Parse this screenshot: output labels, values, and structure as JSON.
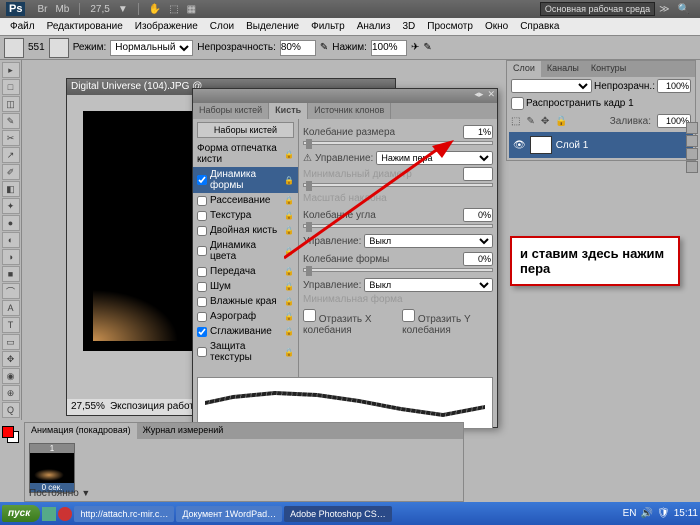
{
  "top": {
    "ps": "Ps",
    "br": "Br",
    "mb": "Mb",
    "zoom": "27,5",
    "hand": "✋",
    "workspace": "Основная рабочая среда",
    "chev": "≫"
  },
  "menu": [
    "Файл",
    "Редактирование",
    "Изображение",
    "Слои",
    "Выделение",
    "Фильтр",
    "Анализ",
    "3D",
    "Просмотр",
    "Окно",
    "Справка"
  ],
  "opt": {
    "size": "551",
    "mode_lbl": "Режим:",
    "mode": "Нормальный",
    "opac_lbl": "Непрозрачность:",
    "opac": "80%",
    "flow_lbl": "Нажим:",
    "flow": "100%"
  },
  "tools": [
    "▸",
    "□",
    "◫",
    "✎",
    "✂",
    "↗",
    "✐",
    "◧",
    "✦",
    "●",
    "◐",
    "◑",
    "■",
    "⌒",
    "A",
    "T",
    "▭",
    "✥",
    "◉",
    "⊕",
    "Q"
  ],
  "doc": {
    "title": "Digital Universe (104).JPG @",
    "zoom": "27,55%",
    "status": "Экспозиция работае"
  },
  "layers": {
    "tabs": [
      "Слои",
      "Каналы",
      "Контуры"
    ],
    "opac_lbl": "Непрозрачн.:",
    "opac": "100%",
    "lock_lbl": "Распространить кадр 1",
    "fill_lbl": "Заливка:",
    "fill": "100%",
    "layer": "Слой 1"
  },
  "note": "и ставим здесь нажим пера",
  "dlg": {
    "tabs": [
      "Наборы кистей",
      "Кисть",
      "Источник клонов"
    ],
    "presets_btn": "Наборы кистей",
    "list": [
      {
        "l": "Форма отпечатка кисти",
        "c": false,
        "nosq": true
      },
      {
        "l": "Динамика формы",
        "c": true,
        "sel": true
      },
      {
        "l": "Рассеивание",
        "c": false
      },
      {
        "l": "Текстура",
        "c": false
      },
      {
        "l": "Двойная кисть",
        "c": false
      },
      {
        "l": "Динамика цвета",
        "c": false
      },
      {
        "l": "Передача",
        "c": false
      },
      {
        "l": "Шум",
        "c": false
      },
      {
        "l": "Влажные края",
        "c": false
      },
      {
        "l": "Аэрограф",
        "c": false
      },
      {
        "l": "Сглаживание",
        "c": true
      },
      {
        "l": "Защита текстуры",
        "c": false
      }
    ],
    "r": {
      "size_jitter": "Колебание размера",
      "size_val": "1%",
      "ctrl": "Управление:",
      "pen": "Нажим пера",
      "off": "Выкл",
      "min_diam": "Минимальный диаметр",
      "min_val": "",
      "tilt": "Масштаб наклона",
      "angle": "Колебание угла",
      "angle_val": "0%",
      "round": "Колебание формы",
      "round_val": "0%",
      "min_round": "Минимальная форма",
      "flipx": "Отразить X колебания",
      "flipy": "Отразить Y колебания"
    }
  },
  "anim": {
    "tabs": [
      "Анимация (покадровая)",
      "Журнал измерений"
    ],
    "frame_num": "1",
    "time": "0 сек.",
    "mode": "Постоянно"
  },
  "taskbar": {
    "start": "пуск",
    "tasks": [
      "http://attach.rc-mir.c…",
      "Документ 1WordPad…",
      "Adobe Photoshop CS…"
    ],
    "lang": "EN",
    "time": "15:11"
  }
}
